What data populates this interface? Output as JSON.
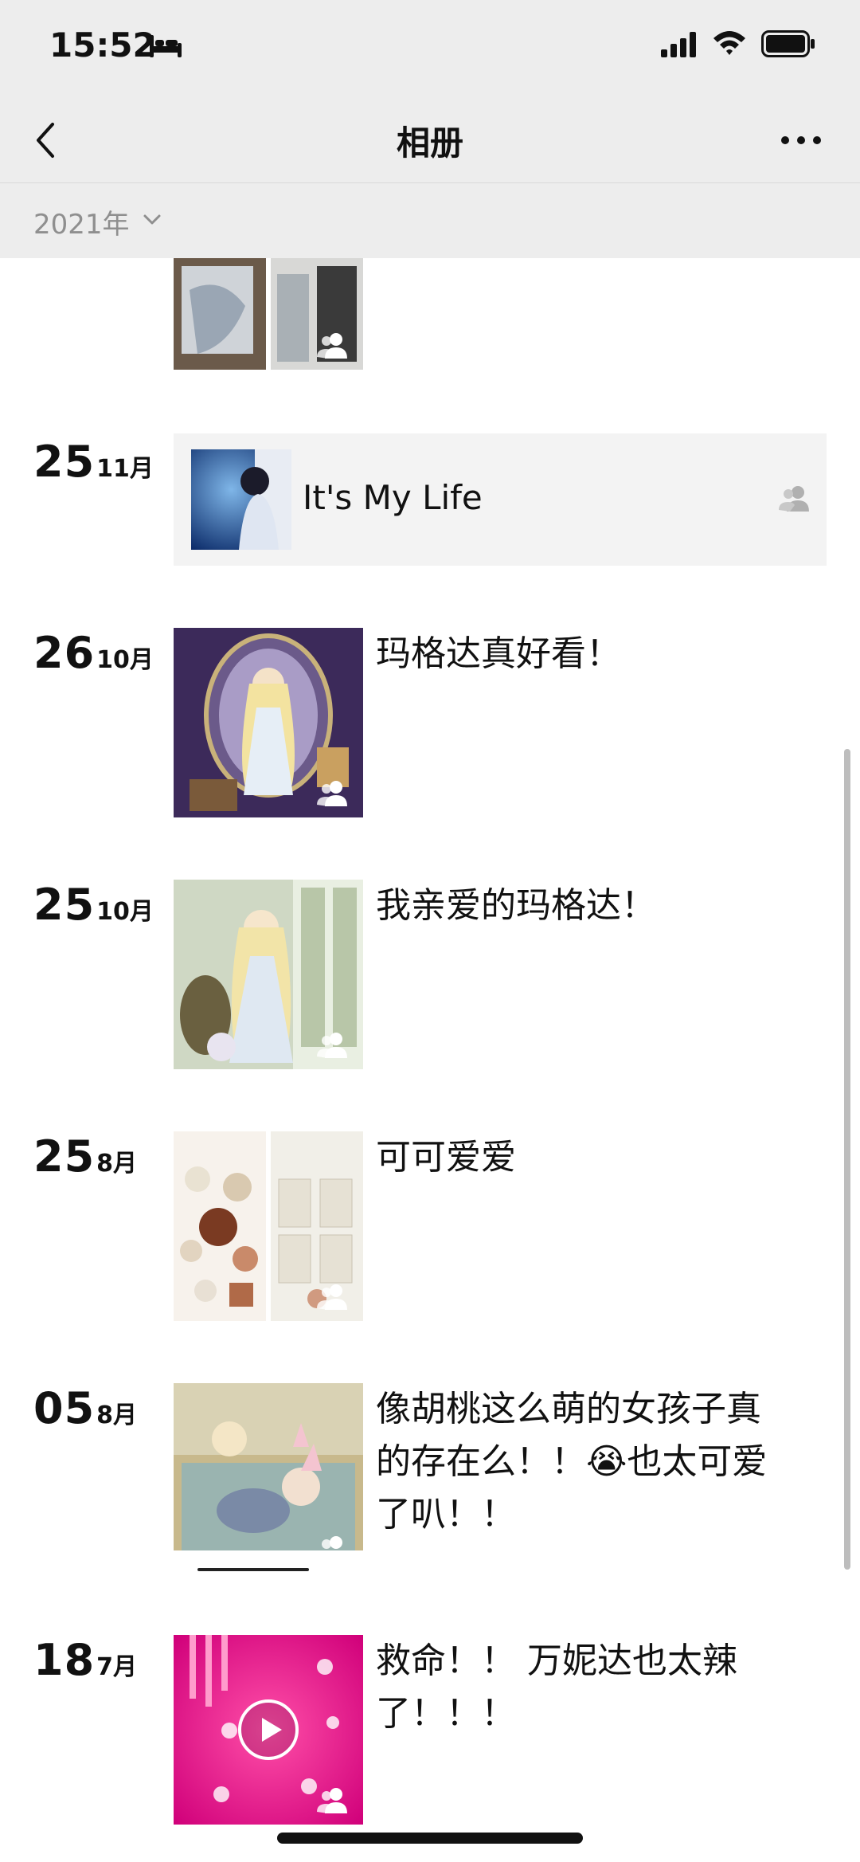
{
  "status_bar": {
    "time": "15:52"
  },
  "nav": {
    "title": "相册"
  },
  "year_filter": {
    "label": "2021年"
  },
  "entries": [
    {
      "day": "25",
      "month": "11月",
      "link_title": "It's My Life"
    },
    {
      "day": "26",
      "month": "10月",
      "caption": "玛格达真好看！"
    },
    {
      "day": "25",
      "month": "10月",
      "caption": "我亲爱的玛格达！"
    },
    {
      "day": "25",
      "month": "8月",
      "caption": "可可爱爱"
    },
    {
      "day": "05",
      "month": "8月",
      "caption": "像胡桃这么萌的女孩子真的存在么！！😭也太可爱了叭！！"
    },
    {
      "day": "18",
      "month": "7月",
      "caption": "救命！！ 万妮达也太辣了！！！"
    }
  ],
  "colors": {
    "bar_background": "#ededed",
    "card_background": "#f3f3f3",
    "muted_text": "#8f8f8f",
    "video_accent": "#ff1a8c"
  }
}
